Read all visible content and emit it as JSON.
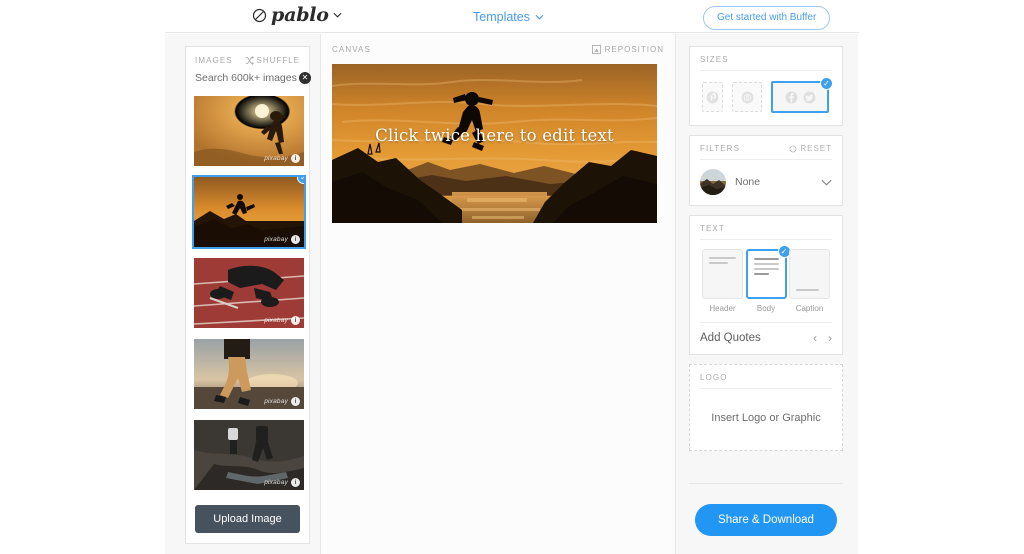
{
  "header": {
    "logo_text": "pablo",
    "logo_icon": "circle-slash-icon",
    "logo_chevron": "chevron-down-icon",
    "templates_label": "Templates",
    "templates_chevron": "chevron-down-icon",
    "buffer_cta": "Get started with Buffer"
  },
  "images_panel": {
    "title": "IMAGES",
    "shuffle_label": "SHUFFLE",
    "shuffle_icon": "shuffle-icon",
    "search_value": "Search 600k+ images",
    "search_placeholder": "Search 600k+ images",
    "clear_icon": "close-icon",
    "upload_label": "Upload Image",
    "watermark": "pixabay",
    "watermark_info": "i",
    "scroll_up_icon": "triangle-up-icon",
    "scroll_down_icon": "triangle-down-icon",
    "thumbs": [
      {
        "alt": "woman running at sunset",
        "selected": false
      },
      {
        "alt": "person jumping over cliff at sunset",
        "selected": true
      },
      {
        "alt": "sprinter at starting blocks on red track",
        "selected": false
      },
      {
        "alt": "runner legs on road at sunrise",
        "selected": false
      },
      {
        "alt": "two trail runners in stream",
        "selected": false
      }
    ]
  },
  "canvas": {
    "title": "CANVAS",
    "reposition_label": "REPOSITION",
    "reposition_icon": "reposition-icon",
    "overlay_text": "Click twice here to edit text",
    "image_alt": "person jumping over cliff at sunset"
  },
  "sizes": {
    "title": "SIZES",
    "options": [
      {
        "name": "pinterest",
        "icon": "pinterest-icon",
        "selected": false
      },
      {
        "name": "instagram",
        "icon": "instagram-icon",
        "selected": false
      },
      {
        "name": "facebook-twitter",
        "icon": "facebook-twitter-icon",
        "selected": true
      }
    ]
  },
  "filters": {
    "title": "FILTERS",
    "reset_label": "RESET",
    "reset_icon": "reset-icon",
    "selected": "None",
    "chevron": "chevron-down-icon"
  },
  "text": {
    "title": "TEXT",
    "options": [
      {
        "label": "Header",
        "selected": false
      },
      {
        "label": "Body",
        "selected": true
      },
      {
        "label": "Caption",
        "selected": false
      }
    ],
    "quotes_label": "Add Quotes",
    "prev_icon": "chevron-left-icon",
    "next_icon": "chevron-right-icon"
  },
  "logo": {
    "title": "LOGO",
    "placeholder": "Insert Logo or Graphic"
  },
  "footer": {
    "share_label": "Share & Download"
  },
  "colors": {
    "accent_blue": "#2196f3",
    "select_blue": "#3fa0ef",
    "upload_slate": "#46525e"
  }
}
